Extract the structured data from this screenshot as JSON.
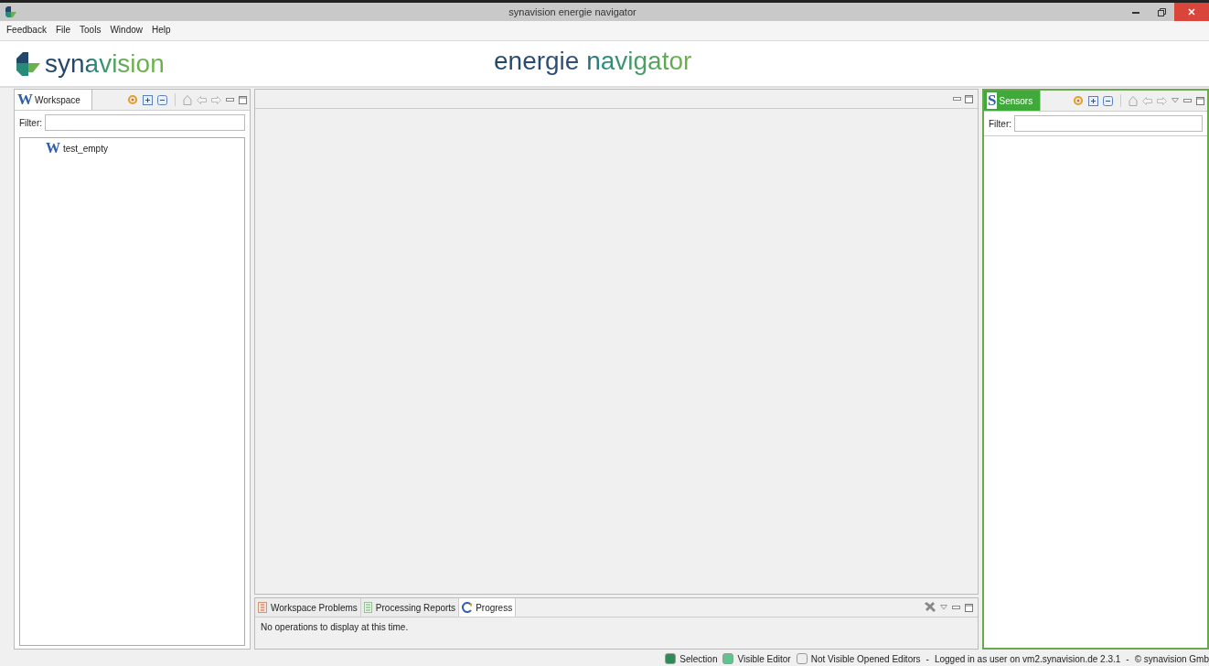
{
  "window": {
    "title": "synavision energie navigator"
  },
  "menu": [
    "Feedback",
    "File",
    "Tools",
    "Window",
    "Help"
  ],
  "header": {
    "logo": "synavision",
    "title": "energie navigator"
  },
  "workspace_panel": {
    "tab": {
      "icon_letter": "W",
      "label": "Workspace",
      "active": false
    },
    "filter_label": "Filter:",
    "tree": [
      {
        "icon_letter": "W",
        "label": "test_empty",
        "selected": false
      }
    ]
  },
  "sensors_panel": {
    "tab": {
      "icon_letter": "S",
      "label": "Sensors",
      "active": true
    },
    "filter_label": "Filter:"
  },
  "bottom_panel": {
    "tabs": [
      {
        "kind": "problems",
        "label": "Workspace Problems",
        "selected": false
      },
      {
        "kind": "reports",
        "label": "Processing Reports",
        "selected": false
      },
      {
        "kind": "progress",
        "label": "Progress",
        "selected": true
      }
    ],
    "message": "No operations to display at this time."
  },
  "status_bar": {
    "legend": [
      {
        "label": "Selection",
        "color": "#2e8b57"
      },
      {
        "label": "Visible Editor",
        "color": "#5ec48e"
      },
      {
        "label": "Not Visible Opened Editors",
        "color": "#eeeeee"
      }
    ],
    "texts": [
      "-",
      "Logged in as user on vm2.synavision.de 2.3.1",
      "-",
      "© synavision Gmb"
    ]
  }
}
